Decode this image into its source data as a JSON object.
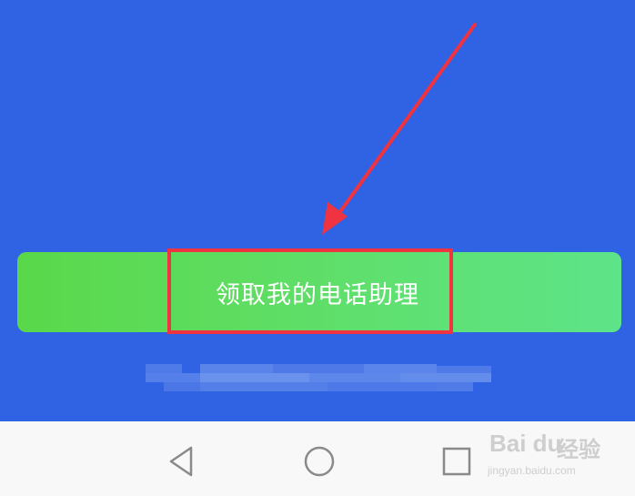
{
  "main": {
    "claim_button_label": "领取我的电话助理"
  },
  "annotation": {
    "arrow_color": "#ef3340",
    "highlight_color": "#ef3340"
  },
  "nav_bar": {
    "back_icon": "back-triangle-icon",
    "home_icon": "home-circle-icon",
    "recents_icon": "recents-square-icon"
  },
  "watermark": {
    "logo": "Bai du",
    "text_cn": "经验",
    "url": "jingyan.baidu.com"
  },
  "colors": {
    "background": "#2f63e3",
    "button_gradient_start": "#5ad84a",
    "button_gradient_end": "#5ee489",
    "nav_background": "#f8f8f8"
  }
}
